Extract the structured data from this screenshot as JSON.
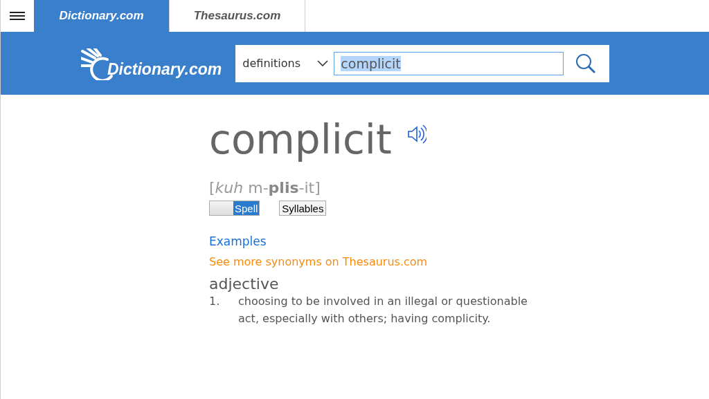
{
  "tabs": [
    {
      "label": "Dictionary.com",
      "selected": true
    },
    {
      "label": "Thesaurus.com",
      "selected": false
    }
  ],
  "header": {
    "logo_text": "Dictionary.com",
    "search_type": "definitions",
    "search": {
      "value": "complicit",
      "highlighted": true
    }
  },
  "entry": {
    "word": "complicit",
    "pronunciation": "[*kuh* m-**plis**-it]",
    "toggles": [
      {
        "label": "Spell",
        "kind": "switch",
        "on": true
      },
      {
        "label": "Syllables",
        "kind": "button"
      }
    ],
    "examples_link": "Examples",
    "synonyms_link": "See more synonyms on Thesaurus.com",
    "part_of_speech": "adjective",
    "definitions": [
      {
        "number": "1.",
        "text": "choosing to be involved in an illegal or questionable act, especially with others; having complicity."
      }
    ]
  }
}
